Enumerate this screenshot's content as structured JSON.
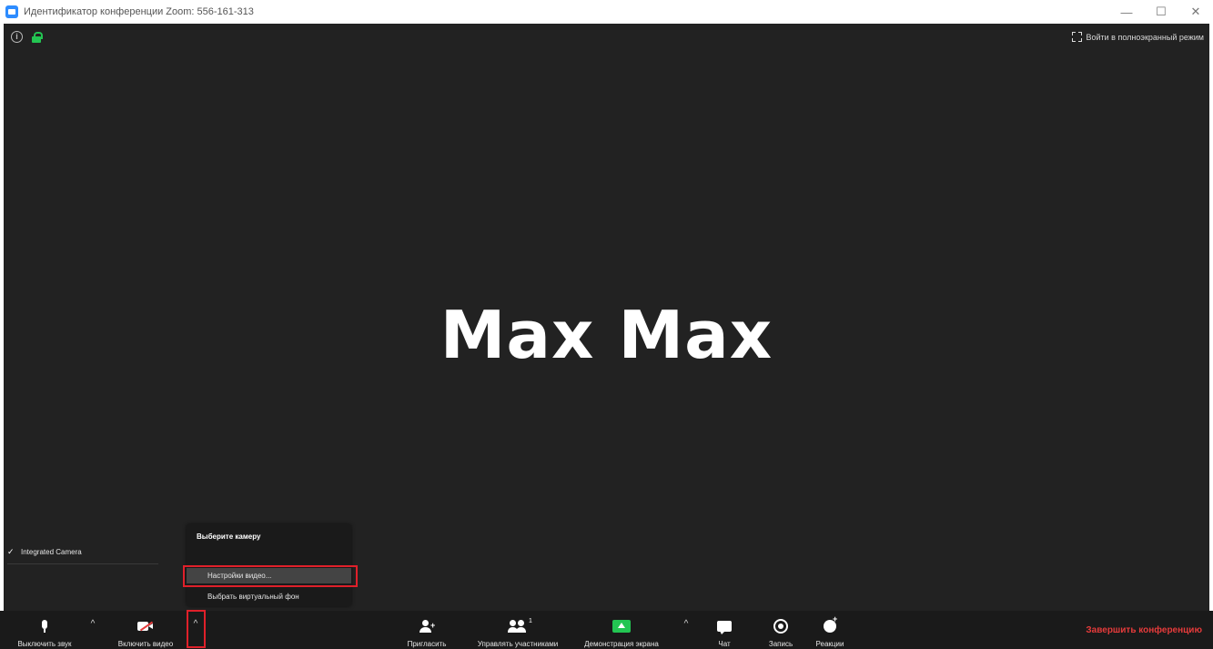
{
  "window": {
    "title": "Идентификатор конференции Zoom: 556-161-313",
    "minimize": "—",
    "maximize": "☐",
    "close": "✕"
  },
  "video": {
    "participant_name": "Max Max",
    "fullscreen_label": "Войти в полноэкранный режим"
  },
  "camera_menu": {
    "heading": "Выберите камеру",
    "camera_item": "Integrated Camera",
    "camera_checked": "✓",
    "settings_item": "Настройки видео...",
    "virtual_bg_item": "Выбрать виртуальный фон"
  },
  "toolbar": {
    "mute_label": "Выключить звук",
    "video_label": "Включить видео",
    "invite_label": "Пригласить",
    "participants_label": "Управлять участниками",
    "participants_count": "1",
    "share_label": "Демонстрация экрана",
    "chat_label": "Чат",
    "record_label": "Запись",
    "reactions_label": "Реакции",
    "end_label": "Завершить конференцию",
    "caret": "^"
  },
  "colors": {
    "video_bg": "#222222",
    "toolbar_bg": "#1a1a1a",
    "accent_green": "#23c552",
    "end_red": "#e53b3b",
    "highlight_red": "#e0202a",
    "zoom_blue": "#2d8cff"
  }
}
